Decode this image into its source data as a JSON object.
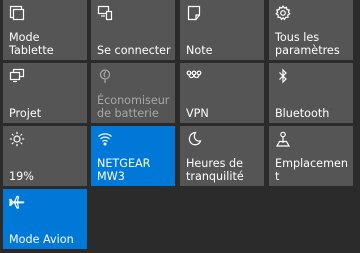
{
  "quick_actions": [
    {
      "id": "tablet-mode",
      "label": "Mode Tablette",
      "icon": "tablet-mode-icon",
      "state": "off"
    },
    {
      "id": "connect",
      "label": "Se connecter",
      "icon": "connect-icon",
      "state": "off"
    },
    {
      "id": "note",
      "label": "Note",
      "icon": "note-icon",
      "state": "off"
    },
    {
      "id": "all-settings",
      "label": "Tous les paramètres",
      "icon": "gear-icon",
      "state": "off"
    },
    {
      "id": "project",
      "label": "Projet",
      "icon": "project-icon",
      "state": "off"
    },
    {
      "id": "battery-saver",
      "label": "Économiseur de batterie",
      "icon": "battery-saver-icon",
      "state": "disabled"
    },
    {
      "id": "vpn",
      "label": "VPN",
      "icon": "vpn-icon",
      "state": "off"
    },
    {
      "id": "bluetooth",
      "label": "Bluetooth",
      "icon": "bluetooth-icon",
      "state": "off"
    },
    {
      "id": "brightness",
      "label": "19%",
      "icon": "brightness-icon",
      "state": "off"
    },
    {
      "id": "wifi",
      "label": "NETGEAR MW3",
      "icon": "wifi-icon",
      "state": "on"
    },
    {
      "id": "quiet-hours",
      "label": "Heures de tranquilité",
      "icon": "moon-icon",
      "state": "off"
    },
    {
      "id": "location",
      "label": "Emplacement",
      "icon": "location-icon",
      "state": "off"
    },
    {
      "id": "airplane-mode",
      "label": "Mode Avion",
      "icon": "airplane-icon",
      "state": "on"
    }
  ],
  "colors": {
    "background": "#2b2b2b",
    "tile_off": "#555555",
    "tile_on": "#0078d7",
    "text": "#ffffff",
    "text_disabled": "#a8a8a8"
  }
}
